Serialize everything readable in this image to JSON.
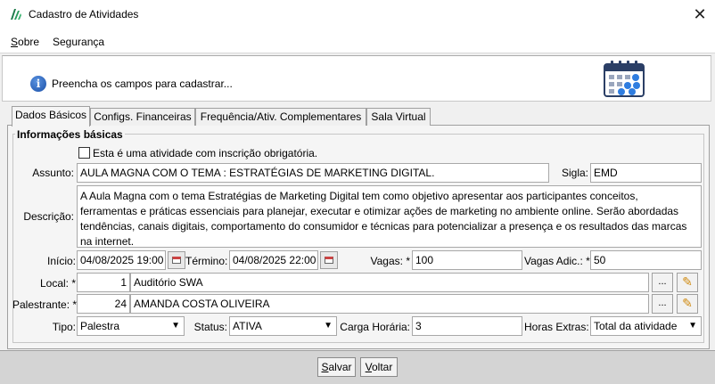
{
  "window": {
    "title": "Cadastro de Atividades",
    "close_glyph": "✕"
  },
  "menu": [
    {
      "label": "Sobre",
      "underline": "S",
      "rest": "obre"
    },
    {
      "label": "Segurança"
    }
  ],
  "header": {
    "info_text": "Preencha os campos para cadastrar...",
    "info_glyph": "i"
  },
  "tabs": [
    {
      "label": "Dados Básicos",
      "active": true
    },
    {
      "label": "Configs. Financeiras"
    },
    {
      "label": "Frequência/Ativ. Complementares"
    },
    {
      "label": "Sala Virtual"
    }
  ],
  "form": {
    "group_title": "Informações básicas",
    "checkbox_label": "Esta é uma atividade com inscrição obrigatória.",
    "checkbox_checked": false,
    "assunto_label": "Assunto:",
    "assunto_value": "AULA MAGNA COM O TEMA : ESTRATÉGIAS DE MARKETING DIGITAL.",
    "sigla_label": "Sigla:",
    "sigla_value": "EMD",
    "descricao_label": "Descrição:",
    "descricao_value": "A Aula Magna com o tema Estratégias de Marketing Digital tem como objetivo apresentar aos participantes conceitos, ferramentas e práticas essenciais para planejar, executar e otimizar ações de marketing no ambiente online. Serão abordadas tendências, canais digitais, comportamento do consumidor e técnicas para potencializar a presença e os resultados das marcas na internet.",
    "inicio_label": "Início:",
    "inicio_value": "04/08/2025 19:00",
    "termino_label": "Término:",
    "termino_value": "04/08/2025 22:00",
    "vagas_label": "Vagas: *",
    "vagas_value": "100",
    "vagas_adic_label": "Vagas Adic.: *",
    "vagas_adic_value": "50",
    "local_label": "Local: *",
    "local_code": "1",
    "local_name": "Auditório SWA",
    "palestrante_label": "Palestrante: *",
    "palestrante_code": "24",
    "palestrante_name": "AMANDA COSTA OLIVEIRA",
    "tipo_label": "Tipo:",
    "tipo_value": "Palestra",
    "status_label": "Status:",
    "status_value": "ATIVA",
    "carga_label": "Carga Horária:",
    "carga_value": "3",
    "horas_extras_label": "Horas Extras:",
    "horas_extras_value": "Total da atividade",
    "ellipsis": "...",
    "edit_glyph": "✎"
  },
  "footer": {
    "salvar_underline": "S",
    "salvar_rest": "alvar",
    "salvar_label": "Salvar",
    "voltar_underline": "V",
    "voltar_rest": "oltar",
    "voltar_label": "Voltar"
  },
  "colors": {
    "accent": "#1a4fa8",
    "pencil": "#e8a21a"
  }
}
